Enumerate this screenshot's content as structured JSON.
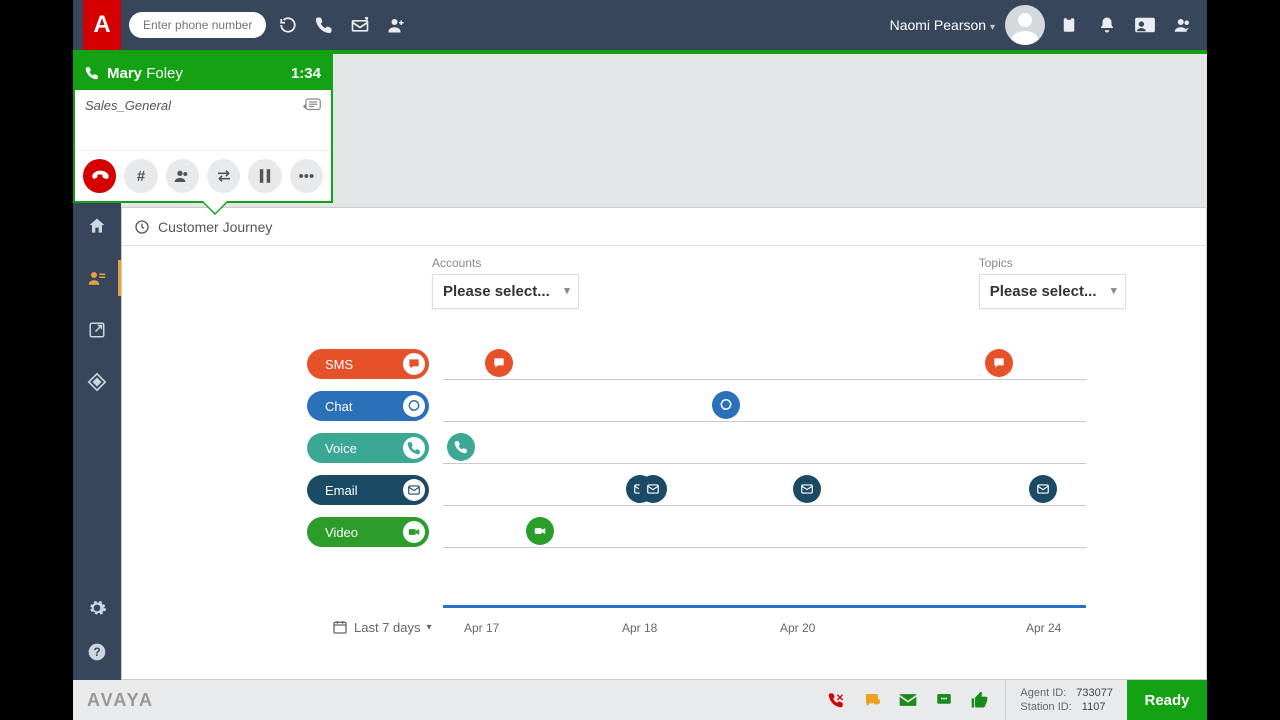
{
  "topbar": {
    "phone_placeholder": "Enter phone number",
    "user_name": "Naomi Pearson"
  },
  "call": {
    "first_name": "Mary",
    "last_name": "Foley",
    "duration": "1:34",
    "queue": "Sales_General"
  },
  "panel": {
    "title": "Customer Journey",
    "filters": {
      "accounts_label": "Accounts",
      "topics_label": "Topics",
      "placeholder": "Please select..."
    },
    "date_range": "Last 7 days"
  },
  "channels": {
    "sms": "SMS",
    "chat": "Chat",
    "voice": "Voice",
    "email": "Email",
    "video": "Video"
  },
  "chart_data": {
    "type": "scatter",
    "title": "Customer Journey",
    "xlabel": "",
    "ylabel": "",
    "x_range": [
      "Apr 17",
      "Apr 24"
    ],
    "x_ticks": [
      "Apr 17",
      "Apr 18",
      "Apr 20",
      "Apr 24"
    ],
    "categories": [
      "SMS",
      "Chat",
      "Voice",
      "Email",
      "Video"
    ],
    "series": [
      {
        "name": "SMS",
        "values": [
          "Apr 17",
          "Apr 24"
        ]
      },
      {
        "name": "Chat",
        "values": [
          "Apr 19"
        ]
      },
      {
        "name": "Voice",
        "values": [
          "Apr 17"
        ]
      },
      {
        "name": "Email",
        "values": [
          "Apr 18",
          "Apr 18",
          "Apr 20",
          "Apr 24"
        ]
      },
      {
        "name": "Video",
        "values": [
          "Apr 17"
        ]
      }
    ]
  },
  "xaxis": {
    "t1": "Apr 17",
    "t2": "Apr 18",
    "t3": "Apr 20",
    "t4": "Apr 24"
  },
  "footer": {
    "brand": "AVAYA",
    "agent_id_label": "Agent ID:",
    "agent_id": "733077",
    "station_id_label": "Station ID:",
    "station_id": "1107",
    "ready": "Ready"
  }
}
